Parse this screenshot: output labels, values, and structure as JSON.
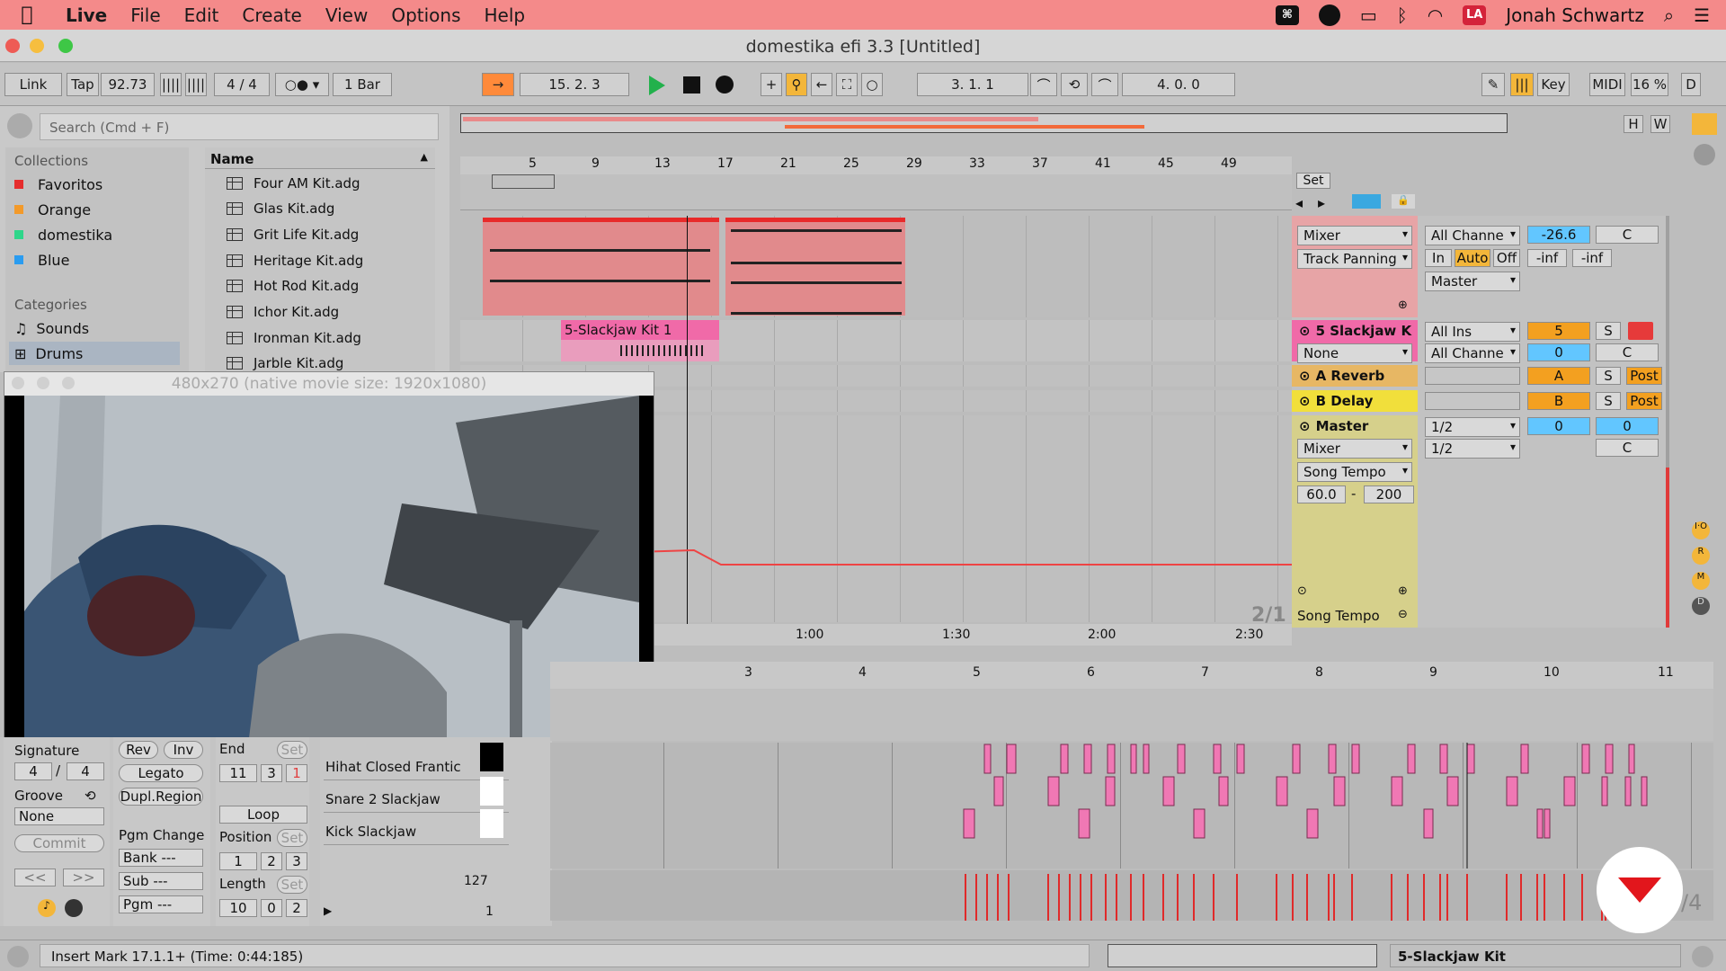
{
  "menubar": {
    "app": "Live",
    "items": [
      "File",
      "Edit",
      "Create",
      "View",
      "Options",
      "Help"
    ],
    "user": "Jonah Schwartz"
  },
  "window": {
    "title": "domestika efi 3.3  [Untitled]"
  },
  "control_bar": {
    "link": "Link",
    "tap": "Tap",
    "tempo": "92.73",
    "signature": "4 / 4",
    "quantize": "1 Bar",
    "position": "15.   2.   3",
    "loop_start": "3.   1.   1",
    "loop_length": "4.   0.   0",
    "key": "Key",
    "midi": "MIDI",
    "cpu": "16 %",
    "d": "D"
  },
  "browser": {
    "search_placeholder": "Search (Cmd + F)",
    "collections_title": "Collections",
    "collections": [
      {
        "label": "Favoritos",
        "color": "#e52d2d"
      },
      {
        "label": "Orange",
        "color": "#f39a2a"
      },
      {
        "label": "domestika",
        "color": "#2ed68a"
      },
      {
        "label": "Blue",
        "color": "#2a9cf0"
      }
    ],
    "categories_title": "Categories",
    "categories": [
      "Sounds",
      "Drums"
    ],
    "name_header": "Name",
    "files": [
      "Four AM Kit.adg",
      "Glas Kit.adg",
      "Grit Life Kit.adg",
      "Heritage Kit.adg",
      "Hot Rod Kit.adg",
      "Ichor Kit.adg",
      "Ironman Kit.adg",
      "Jarble Kit.adg"
    ]
  },
  "arrangement": {
    "bar_numbers": [
      "5",
      "9",
      "13",
      "17",
      "21",
      "25",
      "29",
      "33",
      "37",
      "41",
      "45",
      "49"
    ],
    "time_labels": [
      "1:00",
      "1:30",
      "2:00",
      "2:30"
    ],
    "set_label": "Set",
    "page_indicator": "2/1",
    "clip_name": "5-Slackjaw Kit 1"
  },
  "io": {
    "row1": {
      "mixer": "Mixer",
      "channel": "All Channe",
      "vol": "-26.6",
      "pan": "C",
      "panning": "Track Panning",
      "in": "In",
      "auto": "Auto",
      "off": "Off",
      "inf1": "-inf",
      "inf2": "-inf",
      "out": "Master"
    },
    "slackjaw": {
      "name": "5 Slackjaw K",
      "input": "All Ins",
      "num": "5",
      "s": "S",
      "none": "None",
      "channel": "All Channe",
      "vol": "0",
      "pan": "C"
    },
    "reverb": {
      "name": "A Reverb",
      "letter": "A",
      "s": "S",
      "post": "Post"
    },
    "delay": {
      "name": "B Delay",
      "letter": "B",
      "s": "S",
      "post": "Post"
    },
    "master": {
      "name": "Master",
      "out": "1/2",
      "out2": "1/2",
      "vol": "0",
      "vol2": "0",
      "pan": "C",
      "mixer": "Mixer",
      "song_tempo": "Song Tempo",
      "min": "60.0",
      "max": "200",
      "dash": "-"
    },
    "lane_label": "Song Tempo"
  },
  "video": {
    "title": "480x270 (native movie size: 1920x1080)"
  },
  "clip": {
    "signature_label": "Signature",
    "sig_num": "4",
    "sig_den": "4",
    "slash": "/",
    "groove_label": "Groove",
    "groove_value": "None",
    "commit": "Commit",
    "prev": "<<",
    "next": ">>",
    "rev": "Rev",
    "inv": "Inv",
    "legato": "Legato",
    "dupl": "Dupl.Region",
    "pgm_change": "Pgm Change",
    "bank": "Bank ---",
    "sub": "Sub ---",
    "pgm": "Pgm ---",
    "end_label": "End",
    "end": [
      "11",
      "3",
      "1"
    ],
    "set": "Set",
    "loop": "Loop",
    "position_label": "Position",
    "position": [
      "1",
      "2",
      "3"
    ],
    "length_label": "Length",
    "length": [
      "10",
      "0",
      "2"
    ]
  },
  "piano": {
    "bars": [
      "3",
      "4",
      "5",
      "6",
      "7",
      "8",
      "9",
      "10",
      "11"
    ],
    "lanes": [
      "Hihat Closed Frantic",
      "Snare 2 Slackjaw",
      "Kick Slackjaw"
    ],
    "vel_max": "127",
    "vel_min": "1",
    "corner": "/4"
  },
  "status": {
    "text": "Insert Mark 17.1.1+ (Time: 0:44:185)",
    "track": "5-Slackjaw Kit"
  },
  "colors": {
    "accent": "#f3b63a",
    "clip_red": "#e04a50",
    "clip_pink": "#f06aa8",
    "note_pink": "#f078b4"
  }
}
